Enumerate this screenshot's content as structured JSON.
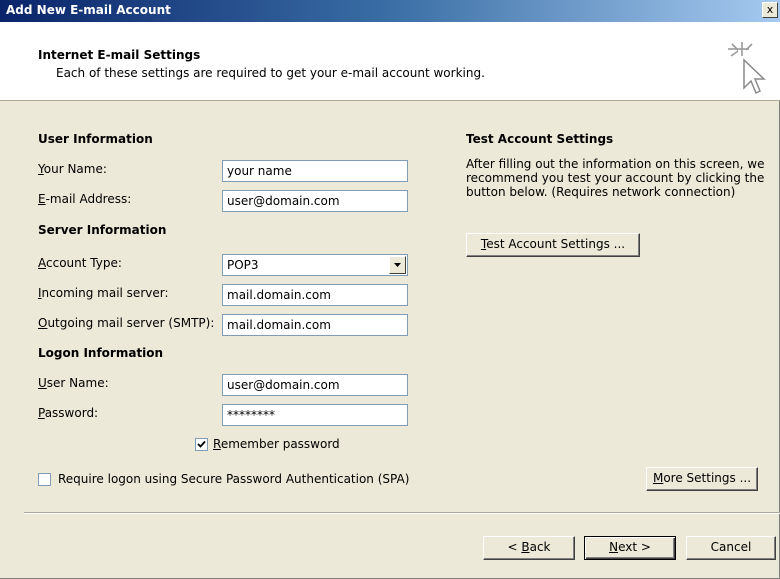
{
  "window": {
    "title": "Add New E-mail Account",
    "close_glyph": "x"
  },
  "header": {
    "title": "Internet E-mail Settings",
    "subtitle": "Each of these settings are required to get your e-mail account working.",
    "icon": "wizard-sparkle-cursor-icon"
  },
  "user_info": {
    "heading": "User Information",
    "name_label_u": "Y",
    "name_label_rest": "our Name:",
    "name_value": "your name",
    "email_label_u": "E",
    "email_label_rest": "-mail Address:",
    "email_value": "user@domain.com"
  },
  "server_info": {
    "heading": "Server Information",
    "account_type_label_u": "A",
    "account_type_label_rest": "ccount Type:",
    "account_type_value": "POP3",
    "incoming_label_u": "I",
    "incoming_label_rest": "ncoming mail server:",
    "incoming_value": "mail.domain.com",
    "outgoing_label_u": "O",
    "outgoing_label_rest": "utgoing mail server (SMTP):",
    "outgoing_value": "mail.domain.com"
  },
  "logon_info": {
    "heading": "Logon Information",
    "username_label_u": "U",
    "username_label_rest": "ser Name:",
    "username_value": "user@domain.com",
    "password_label_u": "P",
    "password_label_rest": "assword:",
    "password_value": "********",
    "remember_label_u": "R",
    "remember_label_rest": "emember password",
    "remember_checked": true,
    "spa_label": "Require logon using Secure Password Authentication (SPA)",
    "spa_checked": false
  },
  "test": {
    "heading": "Test Account Settings",
    "description_line1": "After filling out the information on this screen, we",
    "description_line2": "recommend you test your account by clicking the",
    "description_line3": "button below. (Requires network connection)",
    "button_u": "T",
    "button_rest": "est Account Settings ..."
  },
  "more_settings": {
    "u": "M",
    "rest": "ore Settings ..."
  },
  "footer": {
    "back_prefix": "< ",
    "back_u": "B",
    "back_rest": "ack",
    "next_u": "N",
    "next_rest": "ext >",
    "cancel": "Cancel"
  },
  "colors": {
    "titlebar_start": "#0a246a",
    "dialog_bg": "#ece9d8",
    "field_border": "#7f9db9"
  }
}
